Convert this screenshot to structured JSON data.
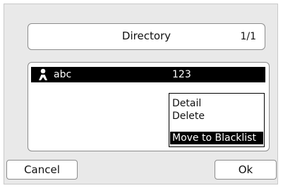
{
  "header": {
    "title": "Directory",
    "page_indicator": "1/1"
  },
  "contacts": [
    {
      "name": "abc",
      "number": "123",
      "icon": "contact-icon",
      "selected": true
    }
  ],
  "context_menu": {
    "items": [
      {
        "label": "Detail",
        "selected": false
      },
      {
        "label": "Delete",
        "selected": false
      },
      {
        "label": "Move to Blacklist",
        "selected": true
      }
    ]
  },
  "softkeys": {
    "left_label": "Cancel",
    "right_label": "Ok"
  },
  "colors": {
    "background": "#e9e9e9",
    "highlight": "#000000",
    "highlight_text": "#ffffff"
  }
}
